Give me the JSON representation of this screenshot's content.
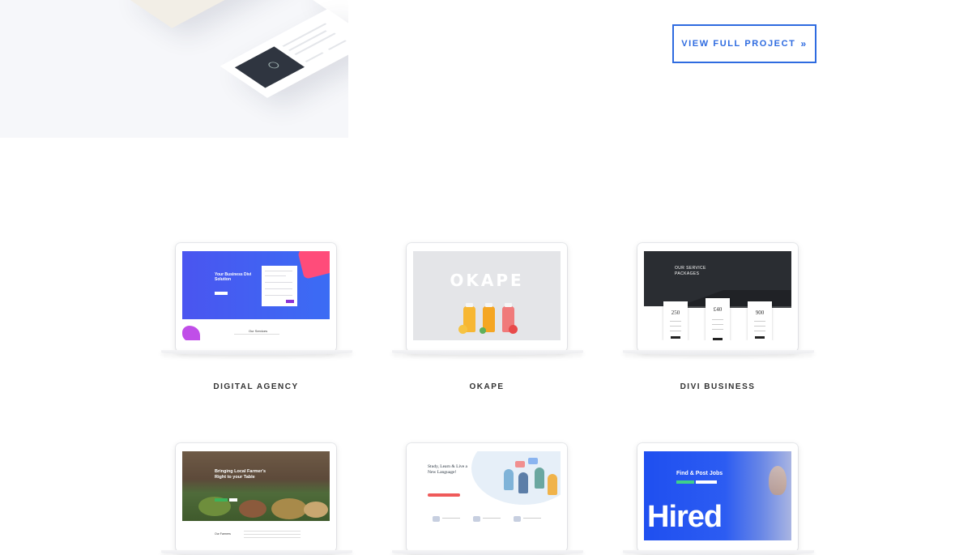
{
  "hero": {
    "cta_label": "VIEW FULL PROJECT",
    "cta_icon": "double-chevron-right-icon"
  },
  "portfolio": {
    "items": [
      {
        "label": "DIGITAL AGENCY",
        "screen": {
          "headline": "Your Business Divi Solution",
          "section": "Our Services"
        }
      },
      {
        "label": "OKAPE",
        "screen": {
          "brand": "OKAPE"
        }
      },
      {
        "label": "DIVI BUSINESS",
        "screen": {
          "heading": "OUR SERVICE PACKAGES",
          "prices": [
            "250",
            "£40",
            "900"
          ]
        }
      },
      {
        "label": "",
        "screen": {
          "headline": "Bringing Local Farmer's Right to your Table",
          "section": "Our Farmers"
        }
      },
      {
        "label": "",
        "screen": {
          "headline": "Study, Learn & Live a New Language!"
        }
      },
      {
        "label": "",
        "screen": {
          "headline": "Find & Post Jobs",
          "big_text": "Hired"
        }
      }
    ]
  },
  "colors": {
    "accent": "#2e6be0",
    "hero_bg": "#f6f7fa"
  }
}
